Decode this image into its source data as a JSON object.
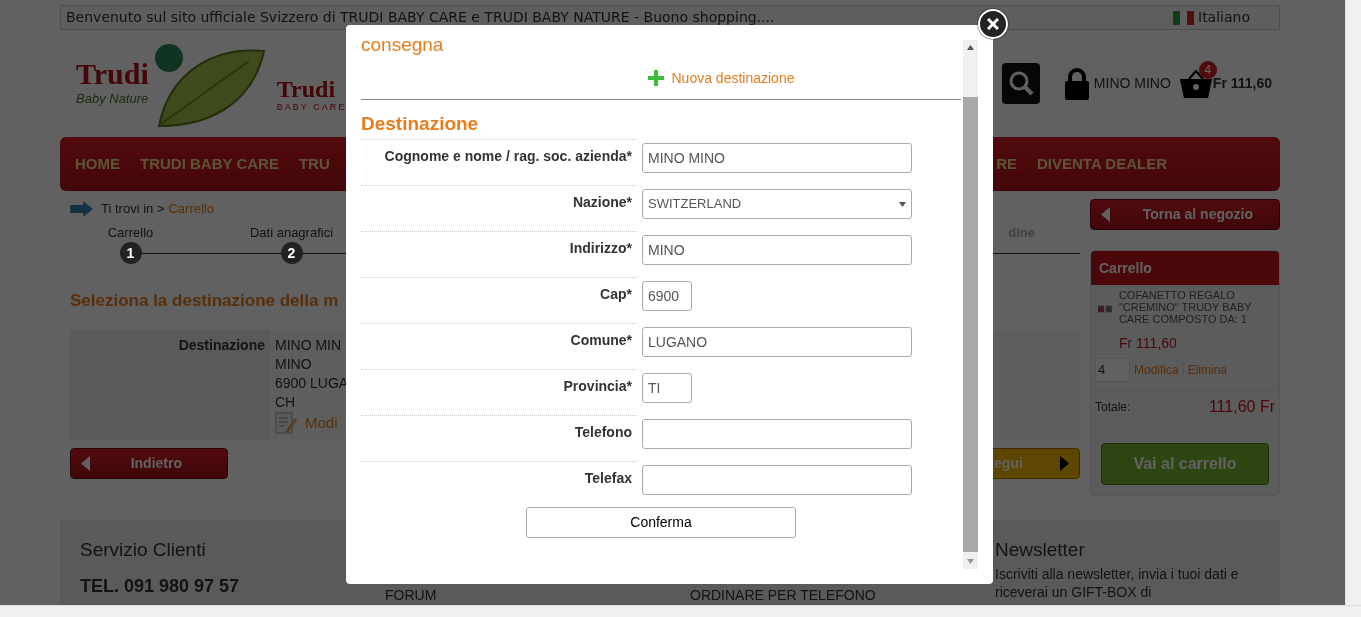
{
  "top_bar": {
    "welcome": "Benvenuto sul sito ufficiale Svizzero di TRUDI BABY CARE e TRUDI BABY NATURE - Buono shopping....",
    "language": "Italiano"
  },
  "header": {
    "logo_left": {
      "brand": "Trudi",
      "line": "Baby Nature"
    },
    "logo_right": {
      "brand": "Trudi",
      "line": "BABY CARE"
    },
    "user": "MINO MINO",
    "cart_count": "4",
    "cart_total": "Fr 111,60"
  },
  "nav": {
    "left": [
      {
        "label": "HOME"
      },
      {
        "label": "TRUDI BABY CARE"
      },
      {
        "label": "TRU"
      }
    ],
    "right": [
      {
        "label": "RE"
      },
      {
        "label": "DIVENTA DEALER"
      }
    ]
  },
  "breadcrumb": {
    "prefix": "Ti trovi in >",
    "current": "Carrello"
  },
  "steps": [
    {
      "label": "Carrello",
      "number": "1"
    },
    {
      "label": "Dati anagrafici",
      "number": "2"
    }
  ],
  "step_cut_label": "dine",
  "heading": "Seleziona la destinazione della m",
  "destination": {
    "label": "Destinazione",
    "lines": [
      "MINO MIN",
      "MINO",
      "6900 LUGA",
      "CH"
    ],
    "edit": "Modi"
  },
  "back_button": "Indietro",
  "next_button": "egui",
  "sidebar": {
    "back_button": "Torna al negozio",
    "cart": {
      "title": "Carrello",
      "item": {
        "name": "COFANETTO REGALO \"CREMINO\" TRUDY BABY CARE COMPOSTO DA: 1",
        "price": "Fr 111,60",
        "quantity": "4",
        "edit": "Modifica",
        "remove": "Elimina"
      },
      "total_label": "Totale:",
      "total": "111,60 Fr",
      "checkout": "Vai al carrello"
    }
  },
  "footer": {
    "service_title": "Servizio Clienti",
    "phone": "TEL. 091 980 97 57",
    "links_1": [
      "FORUM"
    ],
    "links_2": [
      "ORDINARE PER TELEFONO"
    ],
    "newsletter_title": "Newsletter",
    "newsletter_text": "Iscriviti alla newsletter, invia i tuoi dati e riceverai un GIFT-BOX di"
  },
  "modal": {
    "heading": "consegna",
    "new_destination": "Nuova destinazione",
    "section_title": "Destinazione",
    "fields": [
      {
        "label": "Cognome e nome / rag. soc. azienda*",
        "kind": "text",
        "value": "MINO MINO"
      },
      {
        "label": "Nazione*",
        "kind": "select",
        "value": "SWITZERLAND"
      },
      {
        "label": "Indirizzo*",
        "kind": "text",
        "value": "MINO"
      },
      {
        "label": "Cap*",
        "kind": "short",
        "value": "6900"
      },
      {
        "label": "Comune*",
        "kind": "text",
        "value": "LUGANO"
      },
      {
        "label": "Provincia*",
        "kind": "short",
        "value": "TI"
      },
      {
        "label": "Telefono",
        "kind": "text"
      },
      {
        "label": "Telefax",
        "kind": "text"
      }
    ],
    "confirm": "Conferma"
  }
}
